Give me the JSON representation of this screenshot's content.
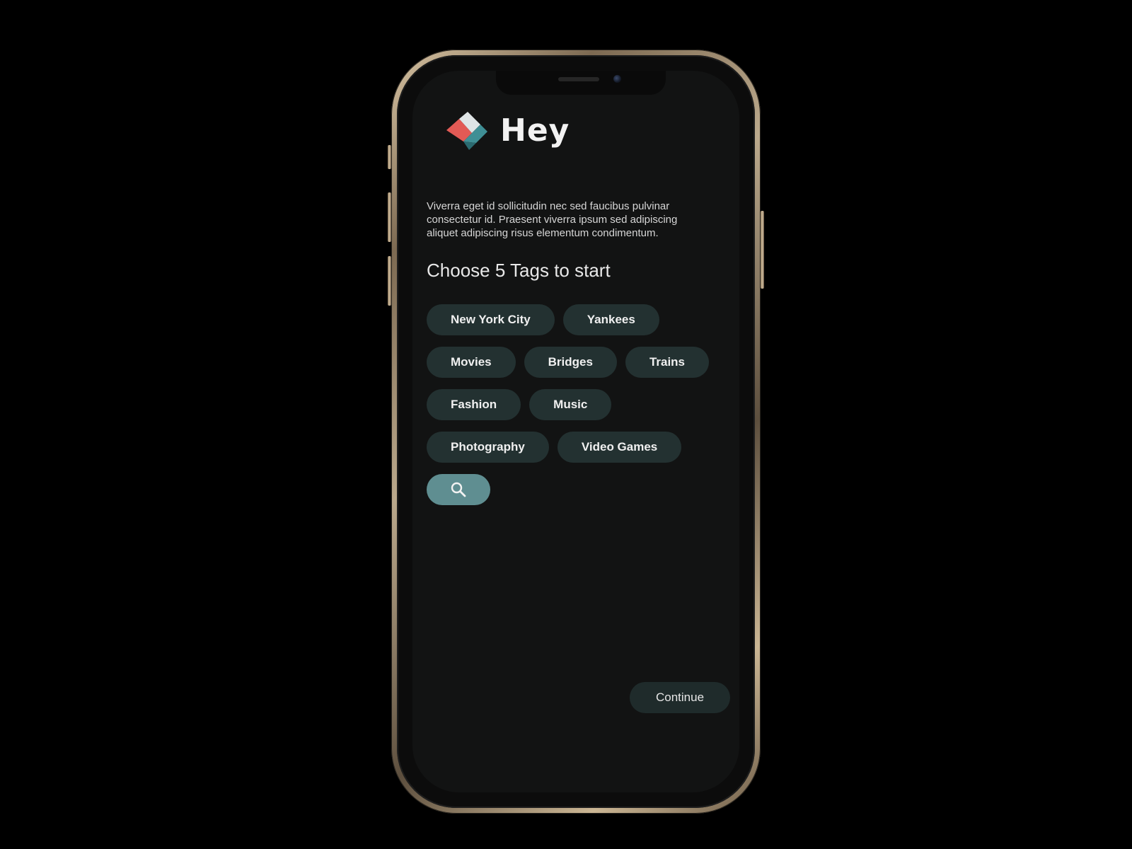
{
  "app": {
    "title": "Hey"
  },
  "intro": {
    "text": "Viverra eget id sollicitudin nec sed faucibus pulvinar consectetur id. Praesent viverra ipsum sed adipiscing aliquet adipiscing risus elementum condimentum."
  },
  "tags_section": {
    "title": "Choose 5 Tags to start",
    "rows": [
      [
        "New York City",
        "Yankees"
      ],
      [
        "Movies",
        "Bridges",
        "Trains"
      ],
      [
        "Fashion",
        "Music"
      ],
      [
        "Photography",
        "Video Games"
      ]
    ],
    "search_icon": "search-icon"
  },
  "actions": {
    "continue_label": "Continue"
  },
  "colors": {
    "tag_bg": "#233131",
    "search_bg": "#5f8e91",
    "screen_bg": "#121313",
    "logo_red": "#e25a55",
    "logo_teal": "#3f8f95",
    "logo_light": "#dfe5e6"
  }
}
